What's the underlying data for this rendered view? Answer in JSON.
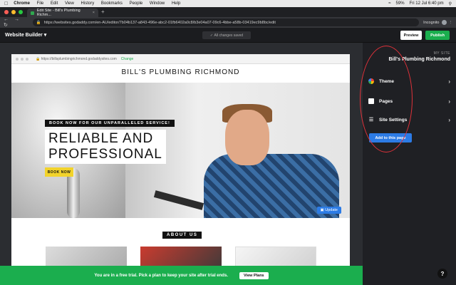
{
  "menubar": {
    "app": "Chrome",
    "items": [
      "File",
      "Edit",
      "View",
      "History",
      "Bookmarks",
      "People",
      "Window",
      "Help"
    ],
    "battery": "59%",
    "datetime": "Fri 12 Jul  6:40 pm"
  },
  "browser": {
    "tab_title": "Edit Site - Bill's Plumbing Richm...",
    "url": "https://websites.godaddy.com/en-AU/editor/7b04b137-a843-496e-abc2-01fb6402a0c8/b3e04a07-09c6-4bbe-a58b-03419ec9b8bc/edit",
    "incognito_label": "Incognito"
  },
  "toolbar": {
    "brand": "Website Builder",
    "saved_status": "All changes saved",
    "preview_label": "Preview",
    "publish_label": "Publish"
  },
  "preview": {
    "site_url": "https://billsplumbingrichmond.godaddysites.com",
    "change_link": "Change",
    "site_title": "BILL'S PLUMBING RICHMOND",
    "tagline": "BOOK NOW FOR OUR UNPARALLELED SERVICE!",
    "headline_line1": "RELIABLE AND",
    "headline_line2": "PROFESSIONAL",
    "cta": "BOOK NOW",
    "update_label": "Update",
    "about_heading": "ABOUT US"
  },
  "panel": {
    "label": "MY SITE",
    "site_name": "Bill's Plumbing Richmond",
    "items": [
      {
        "label": "Theme"
      },
      {
        "label": "Pages"
      },
      {
        "label": "Site Settings"
      }
    ],
    "add_button": "Add to this page"
  },
  "trial_banner": {
    "message": "You are in a free trial. Pick a plan to keep your site after trial ends.",
    "button": "View Plans"
  },
  "colors": {
    "publish_green": "#1bae4e",
    "accent_blue": "#2c7be5",
    "annotation_red": "#e0323a"
  }
}
